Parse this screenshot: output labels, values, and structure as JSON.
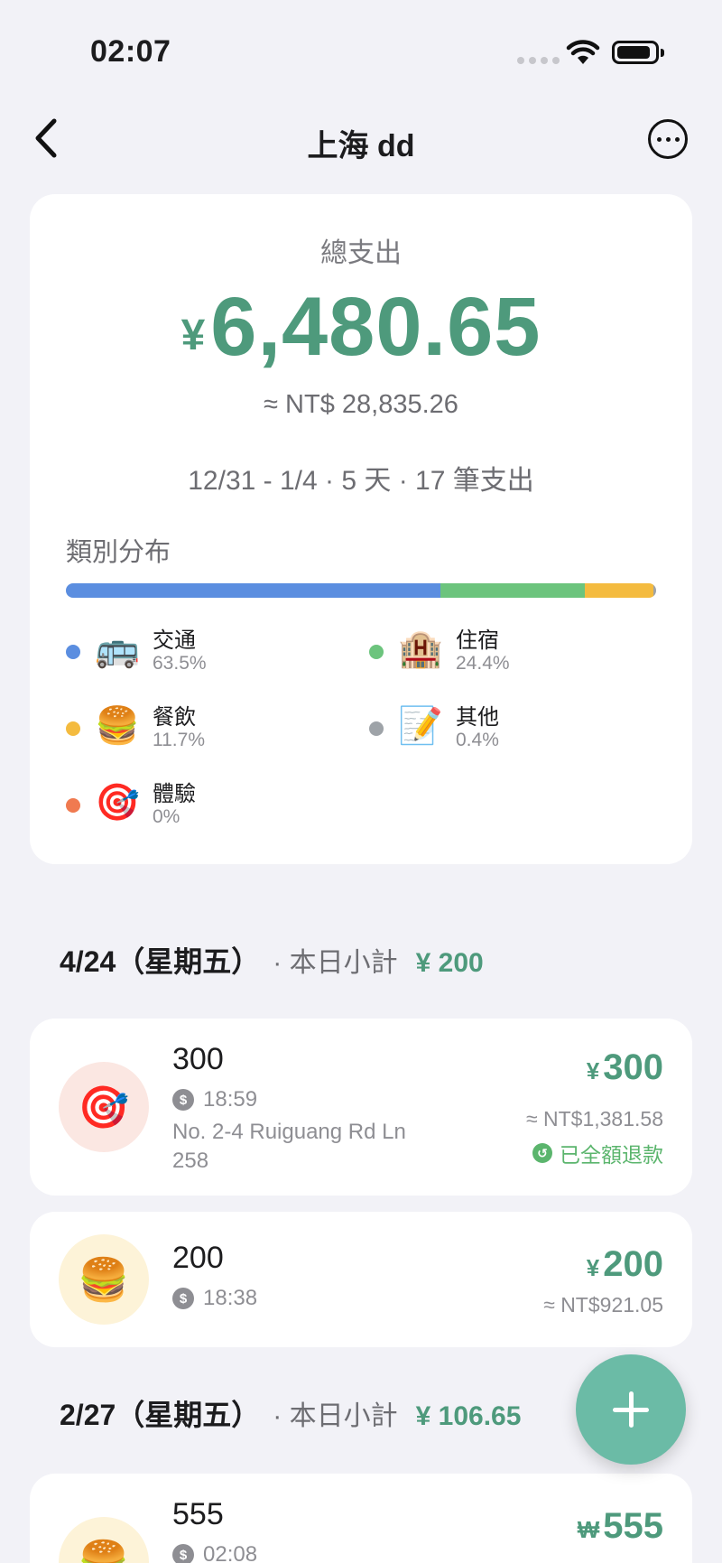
{
  "status_bar": {
    "time": "02:07"
  },
  "nav": {
    "title": "上海 dd"
  },
  "summary": {
    "label": "總支出",
    "currency": "¥",
    "amount": "6,480.65",
    "converted": "≈ NT$ 28,835.26",
    "meta": "12/31 - 1/4 · 5 天 · 17 筆支出",
    "category_title": "類別分布",
    "categories": [
      {
        "name": "交通",
        "pct": "63.5%",
        "value": 63.5,
        "color": "#5b8ee0",
        "icon": "bus-icon",
        "emoji": "🚌"
      },
      {
        "name": "住宿",
        "pct": "24.4%",
        "value": 24.4,
        "color": "#6cc47d",
        "icon": "hotel-icon",
        "emoji": "🏨"
      },
      {
        "name": "餐飲",
        "pct": "11.7%",
        "value": 11.7,
        "color": "#f4bb3f",
        "icon": "burger-icon",
        "emoji": "🍔"
      },
      {
        "name": "其他",
        "pct": "0.4%",
        "value": 0.4,
        "color": "#9ea3a8",
        "icon": "memo-icon",
        "emoji": "📝"
      },
      {
        "name": "體驗",
        "pct": "0%",
        "value": 0,
        "color": "#f07a50",
        "icon": "target-icon",
        "emoji": "🎯"
      }
    ]
  },
  "days": [
    {
      "date": "4/24（星期五）",
      "subtotal_label": "· 本日小計",
      "subtotal": "¥ 200",
      "expenses": [
        {
          "title": "300",
          "time": "18:59",
          "location": "No. 2-4 Ruiguang Rd Ln 258",
          "currency": "¥",
          "amount": "300",
          "converted": "≈ NT$1,381.58",
          "refund": "已全額退款",
          "icon": "target-icon",
          "emoji": "🎯",
          "icon_bg": "#fbe7e2"
        },
        {
          "title": "200",
          "time": "18:38",
          "currency": "¥",
          "amount": "200",
          "converted": "≈ NT$921.05",
          "icon": "burger-icon",
          "emoji": "🍔",
          "icon_bg": "#fdf3d8"
        }
      ]
    },
    {
      "date": "2/27（星期五）",
      "subtotal_label": "· 本日小計",
      "subtotal": "¥ 106.65",
      "expenses": [
        {
          "title": "555",
          "time": "02:08",
          "currency": "₩",
          "amount": "555",
          "icon": "burger-icon",
          "emoji": "🍔",
          "icon_bg": "#fdf3d8"
        }
      ]
    }
  ]
}
